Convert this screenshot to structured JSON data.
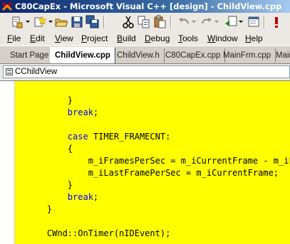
{
  "window": {
    "title": "C80CapEx - Microsoft Visual C++ [design] - ChildView.cpp"
  },
  "toolbar": {
    "buttons": [
      "new-project-icon",
      "add-item-icon",
      "open-icon",
      "save-icon",
      "save-all-icon",
      "cut-icon",
      "copy-icon",
      "paste-icon",
      "undo-icon",
      "redo-icon",
      "navigate-back-icon",
      "solution-explorer-icon",
      "breakpoint-icon"
    ]
  },
  "menu": {
    "items": [
      {
        "first": "F",
        "rest": "ile"
      },
      {
        "first": "E",
        "rest": "dit"
      },
      {
        "first": "V",
        "rest": "iew"
      },
      {
        "first": "P",
        "rest": "roject"
      },
      {
        "first": "B",
        "rest": "uild"
      },
      {
        "first": "D",
        "rest": "ebug"
      },
      {
        "first": "T",
        "rest": "ools"
      },
      {
        "first": "W",
        "rest": "indow"
      },
      {
        "first": "H",
        "rest": "elp"
      }
    ]
  },
  "tabs": [
    "Start Page",
    "ChildView.cpp",
    "ChildView.h",
    "C80CapEx.cpp",
    "MainFrm.cpp",
    "Main"
  ],
  "active_tab": "ChildView.cpp",
  "class_combo": {
    "value": "CChildView"
  },
  "code": {
    "lines": [
      {
        "indent": "        ",
        "parts": [
          {
            "t": "}"
          }
        ]
      },
      {
        "indent": "        ",
        "parts": [
          {
            "t": "break",
            "kw": true
          },
          {
            "t": ";"
          }
        ]
      },
      {
        "indent": "",
        "parts": []
      },
      {
        "indent": "        ",
        "parts": [
          {
            "t": "case",
            "kw": true
          },
          {
            "t": " TIMER_FRAMECNT:"
          }
        ]
      },
      {
        "indent": "        ",
        "parts": [
          {
            "t": "{"
          }
        ]
      },
      {
        "indent": "            ",
        "parts": [
          {
            "t": "m_iFramesPerSec = m_iCurrentFrame - m_iLast"
          }
        ]
      },
      {
        "indent": "            ",
        "parts": [
          {
            "t": "m_iLastFramePerSec = m_iCurrentFrame;"
          }
        ]
      },
      {
        "indent": "        ",
        "parts": [
          {
            "t": "}"
          }
        ]
      },
      {
        "indent": "        ",
        "parts": [
          {
            "t": "break",
            "kw": true
          },
          {
            "t": ";"
          }
        ]
      },
      {
        "indent": "    ",
        "parts": [
          {
            "t": "}"
          }
        ]
      },
      {
        "indent": "",
        "parts": []
      },
      {
        "indent": "    ",
        "parts": [
          {
            "t": "CWnd::OnTimer(nIDEvent);"
          }
        ]
      }
    ]
  },
  "colors": {
    "editor_background": "#ffff00",
    "keyword": "#0000ff",
    "title_bar": "#0a246a"
  }
}
